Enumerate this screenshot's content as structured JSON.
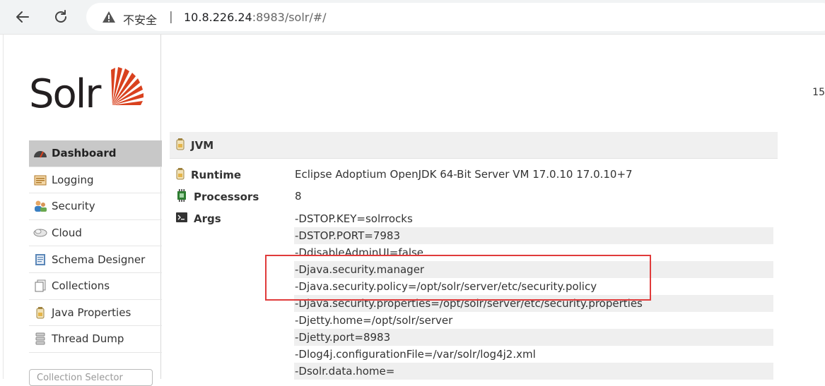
{
  "browser": {
    "insecure_label": "不安全",
    "url_host": "10.8.226.24",
    "url_rest": ":8983/solr/#/"
  },
  "logo": {
    "text": "Solr"
  },
  "menu": [
    {
      "label": "Dashboard",
      "icon": "dashboard-icon",
      "active": true
    },
    {
      "label": "Logging",
      "icon": "logging-icon"
    },
    {
      "label": "Security",
      "icon": "security-icon"
    },
    {
      "label": "Cloud",
      "icon": "cloud-icon"
    },
    {
      "label": "Schema Designer",
      "icon": "schema-designer-icon"
    },
    {
      "label": "Collections",
      "icon": "collections-icon"
    },
    {
      "label": "Java Properties",
      "icon": "java-properties-icon"
    },
    {
      "label": "Thread Dump",
      "icon": "thread-dump-icon"
    }
  ],
  "core_selector": {
    "placeholder": "Collection Selector"
  },
  "top_number": "15",
  "jvm": {
    "title": "JVM",
    "runtime_label": "Runtime",
    "runtime_value": "Eclipse Adoptium OpenJDK 64-Bit Server VM 17.0.10 17.0.10+7",
    "processors_label": "Processors",
    "processors_value": "8",
    "args_label": "Args",
    "args": [
      "-DSTOP.KEY=solrrocks",
      "-DSTOP.PORT=7983",
      "-DdisableAdminUI=false",
      "-Djava.security.manager",
      "-Djava.security.policy=/opt/solr/server/etc/security.policy",
      "-Djava.security.properties=/opt/solr/server/etc/security.properties",
      "-Djetty.home=/opt/solr/server",
      "-Djetty.port=8983",
      "-Dlog4j.configurationFile=/var/solr/log4j2.xml",
      "-Dsolr.data.home="
    ]
  },
  "colors": {
    "highlight": "#e03b3b",
    "solr_orange": "#d9411e",
    "active_menu": "#c8c8c8"
  }
}
